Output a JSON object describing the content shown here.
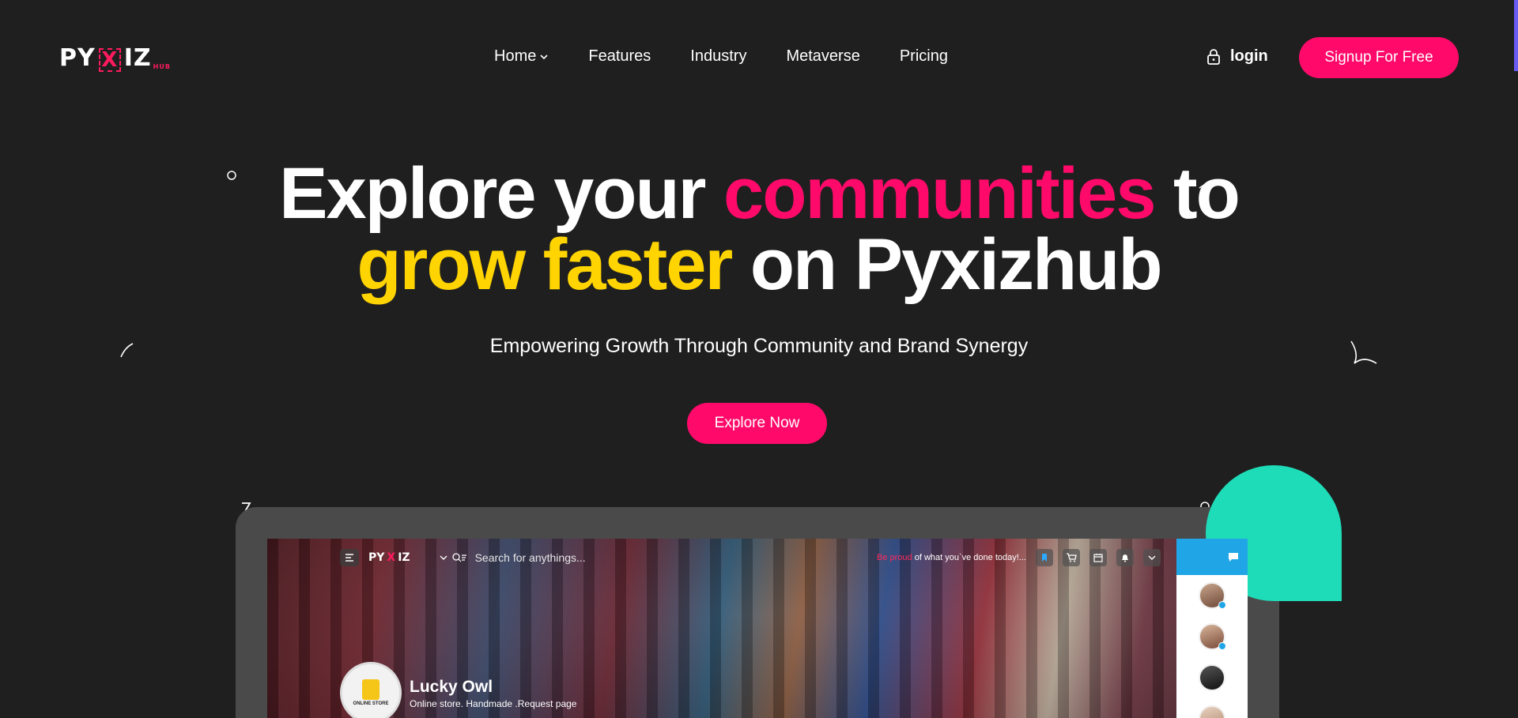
{
  "brand": {
    "logo_left": "PY",
    "logo_x": "X",
    "logo_right": "IZ",
    "logo_suffix": "HUB",
    "accent": "#ff0a6a",
    "highlight": "#ffd400",
    "teal": "#1fdcb8"
  },
  "nav": {
    "items": [
      {
        "label": "Home",
        "has_dropdown": true
      },
      {
        "label": "Features"
      },
      {
        "label": "Industry"
      },
      {
        "label": "Metaverse"
      },
      {
        "label": "Pricing"
      }
    ]
  },
  "auth": {
    "login_label": "login",
    "signup_label": "Signup For Free"
  },
  "hero": {
    "line1_a": "Explore your ",
    "line1_b": "communities",
    "line1_c": " to",
    "line2_a": "grow faster",
    "line2_b": " on Pyxizhub",
    "subtitle": "Empowering Growth Through Community and Brand Synergy",
    "cta_label": "Explore Now"
  },
  "app_preview": {
    "logo_left": "PY",
    "logo_x": "X",
    "logo_right": "IZ",
    "search_placeholder": "Search for anythings...",
    "motto_red": "Be proud",
    "motto_rest": " of what you`ve done today!...",
    "top_icons": [
      "bookmark-icon",
      "cart-icon",
      "calendar-icon",
      "bell-icon",
      "chevron-down-icon"
    ],
    "profile": {
      "name": "Lucky Owl",
      "description": "Online store. Handmade .Request page",
      "badge": "ONLINE STORE"
    }
  }
}
